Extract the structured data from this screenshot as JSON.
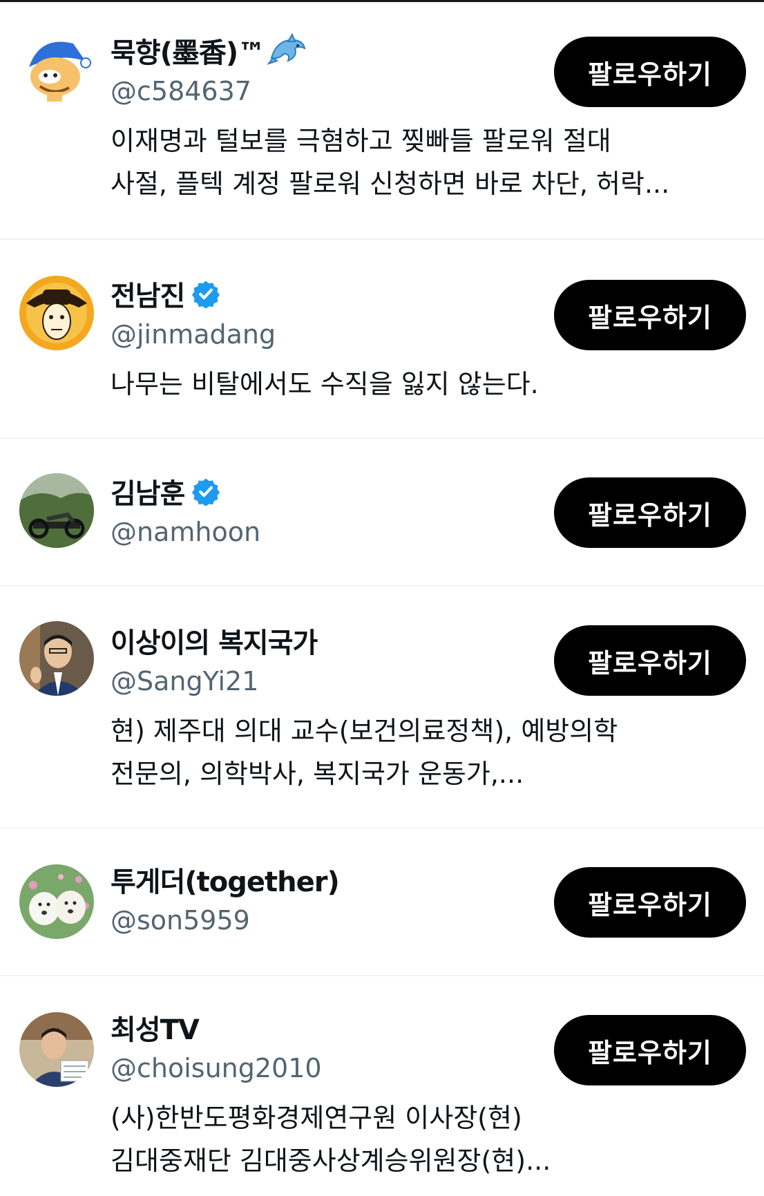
{
  "follow_label": "팔로우하기",
  "accounts": [
    {
      "name": "묵향(墨香)™",
      "handle": "@c584637",
      "verified": false,
      "bio_line1": "이재명과 털보를 극혐하고 찢빠들 팔로워 절대",
      "bio_line2": "사절, 플텍 계정 팔로워 신청하면 바로 차단, 허락..."
    },
    {
      "name": "전남진",
      "handle": "@jinmadang",
      "verified": true,
      "bio_line1": "나무는 비탈에서도 수직을 잃지 않는다.",
      "bio_line2": ""
    },
    {
      "name": "김남훈",
      "handle": "@namhoon",
      "verified": true,
      "bio_line1": "",
      "bio_line2": ""
    },
    {
      "name": "이상이의 복지국가",
      "handle": "@SangYi21",
      "verified": false,
      "bio_line1": "현) 제주대 의대 교수(보건의료정책), 예방의학",
      "bio_line2": "전문의, 의학박사, 복지국가 운동가,..."
    },
    {
      "name": "투게더(together)",
      "handle": "@son5959",
      "verified": false,
      "bio_line1": "",
      "bio_line2": ""
    },
    {
      "name": "최성TV",
      "handle": "@choisung2010",
      "verified": false,
      "bio_line1": "(사)한반도평화경제연구원 이사장(현)",
      "bio_line2": "김대중재단 김대중사상계승위원장(현)..."
    }
  ],
  "colors": {
    "verified_badge": "#1d9bf0",
    "handle_text": "#536471",
    "button_bg": "#000000",
    "divider": "#eff3f4"
  },
  "icons": [
    "verified-badge-icon",
    "dolphin-icon"
  ]
}
